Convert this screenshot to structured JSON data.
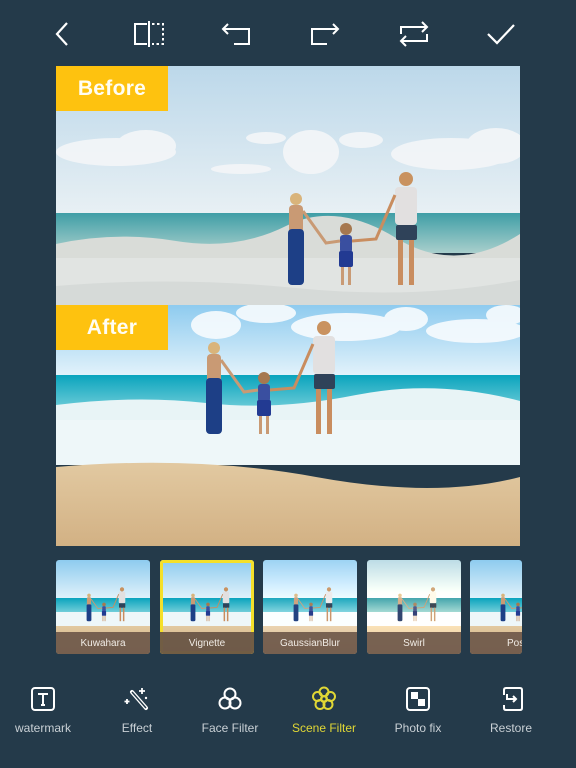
{
  "toolbar": {
    "buttons": [
      {
        "icon": "back-icon"
      },
      {
        "icon": "compare-split-icon"
      },
      {
        "icon": "undo-icon"
      },
      {
        "icon": "redo-icon"
      },
      {
        "icon": "repeat-icon"
      },
      {
        "icon": "checkmark-icon"
      }
    ]
  },
  "preview": {
    "before_label": "Before",
    "after_label": "After"
  },
  "filters": {
    "items": [
      {
        "label": "Kuwahara",
        "selected": false
      },
      {
        "label": "Vignette",
        "selected": true
      },
      {
        "label": "GaussianBlur",
        "selected": false
      },
      {
        "label": "Swirl",
        "selected": false
      },
      {
        "label": "Post",
        "selected": false
      }
    ],
    "selected_border_color": "#f5e02a"
  },
  "bottom_nav": {
    "items": [
      {
        "label": "watermark",
        "icon": "text-box-icon",
        "active": false
      },
      {
        "label": "Effect",
        "icon": "magic-wand-icon",
        "active": false
      },
      {
        "label": "Face Filter",
        "icon": "circles-icon",
        "active": false
      },
      {
        "label": "Scene Filter",
        "icon": "flower-icon",
        "active": true
      },
      {
        "label": "Photo fix",
        "icon": "checker-square-icon",
        "active": false
      },
      {
        "label": "Restore",
        "icon": "restore-icon",
        "active": false
      }
    ],
    "active_color": "#e0d735"
  },
  "colors": {
    "background": "#243a4a",
    "tag": "#fec20f"
  }
}
